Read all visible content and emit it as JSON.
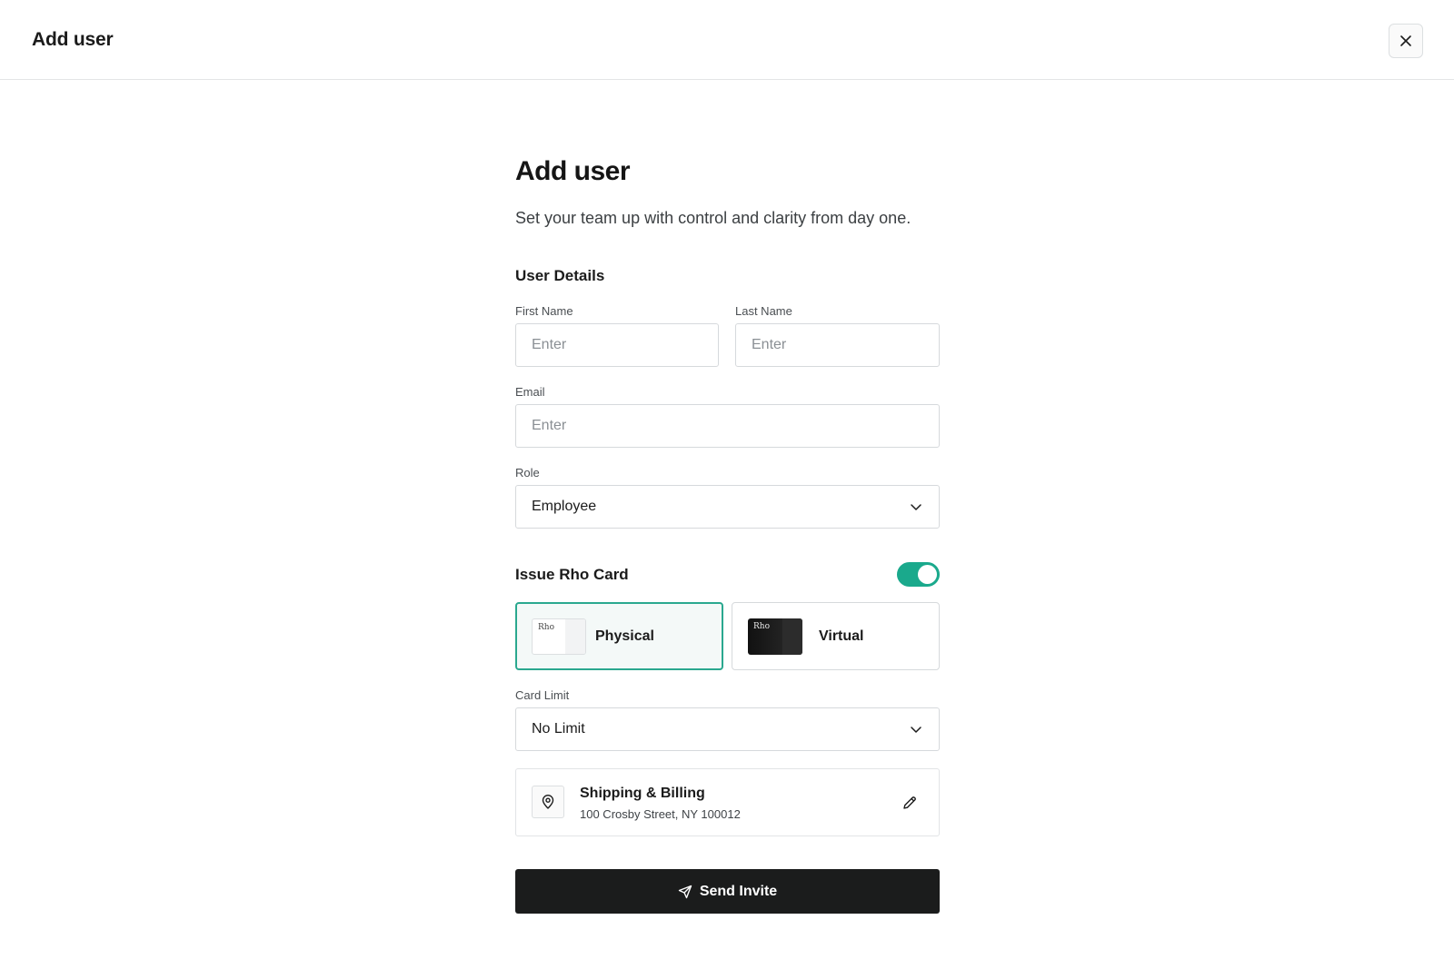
{
  "header": {
    "title": "Add user",
    "close_icon": "close-icon"
  },
  "page": {
    "title": "Add user",
    "subtitle": "Set your team up with control and clarity from day one."
  },
  "user_details": {
    "section_title": "User Details",
    "first_name": {
      "label": "First Name",
      "placeholder": "Enter",
      "value": ""
    },
    "last_name": {
      "label": "Last Name",
      "placeholder": "Enter",
      "value": ""
    },
    "email": {
      "label": "Email",
      "placeholder": "Enter",
      "value": ""
    },
    "role": {
      "label": "Role",
      "value": "Employee",
      "icon": "chevron-down-icon"
    }
  },
  "card": {
    "section_title": "Issue Rho Card",
    "issue_enabled": true,
    "accent_color": "#1aa98c",
    "options": [
      {
        "label": "Physical",
        "brand": "Rho",
        "selected": true
      },
      {
        "label": "Virtual",
        "brand": "Rho",
        "selected": false
      }
    ],
    "limit": {
      "label": "Card Limit",
      "value": "No Limit",
      "icon": "chevron-down-icon"
    }
  },
  "shipping": {
    "title": "Shipping & Billing",
    "address": "100 Crosby Street, NY 100012",
    "icon": "location-pin-icon",
    "edit_icon": "pencil-icon"
  },
  "actions": {
    "send_label": "Send Invite",
    "send_icon": "send-icon",
    "button_color": "#1b1c1c"
  }
}
